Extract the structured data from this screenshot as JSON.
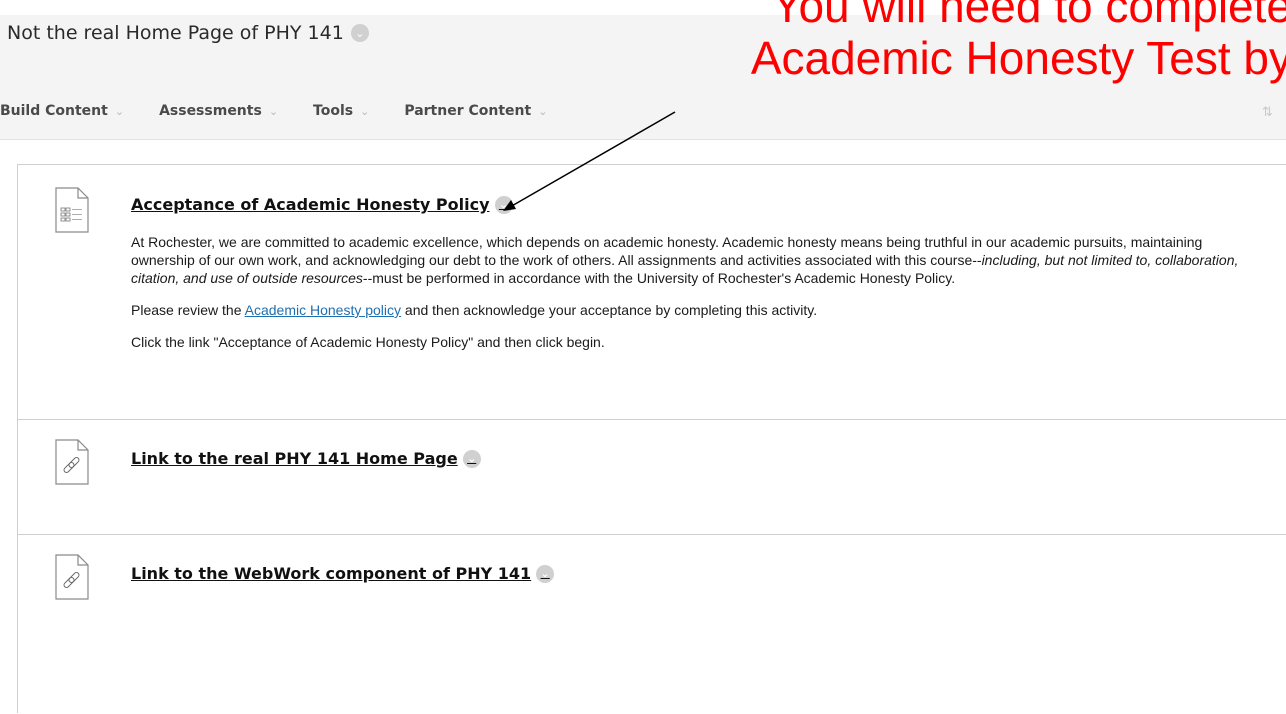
{
  "page": {
    "title": "Not the real Home Page of PHY 141"
  },
  "menu": {
    "items": [
      {
        "label": "Build Content"
      },
      {
        "label": "Assessments"
      },
      {
        "label": "Tools"
      },
      {
        "label": "Partner Content"
      }
    ]
  },
  "overlay": {
    "line1": "You will need to complete",
    "line2": "Academic Honesty Test by",
    "color": "#ff0000"
  },
  "items": [
    {
      "title": "Acceptance of Academic Honesty Policy",
      "icon": "test-document-icon",
      "desc_p1_pre": "At Rochester, we are committed to academic excellence, which depends on academic honesty. Academic honesty means being truthful in our academic pursuits, maintaining ownership of our own work, and acknowledging our debt to the work of others. All assignments and activities associated with this course--",
      "desc_p1_em": "including, but not limited to, collaboration, citation, and use of outside resources",
      "desc_p1_post": "--must be performed in accordance with the University of Rochester's Academic Honesty Policy.",
      "desc_p2_pre": "Please review the ",
      "desc_p2_link": "Academic Honesty policy",
      "desc_p2_post": " and then acknowledge your acceptance by completing this activity.",
      "desc_p3": "Click the link \"Acceptance of Academic Honesty Policy\" and then click begin."
    },
    {
      "title": "Link to the real PHY 141 Home Page",
      "icon": "link-document-icon"
    },
    {
      "title": "Link to the WebWork component of PHY 141",
      "icon": "link-document-icon"
    }
  ],
  "colors": {
    "link": "#1e6fb0",
    "annotation": "#ff0000"
  }
}
